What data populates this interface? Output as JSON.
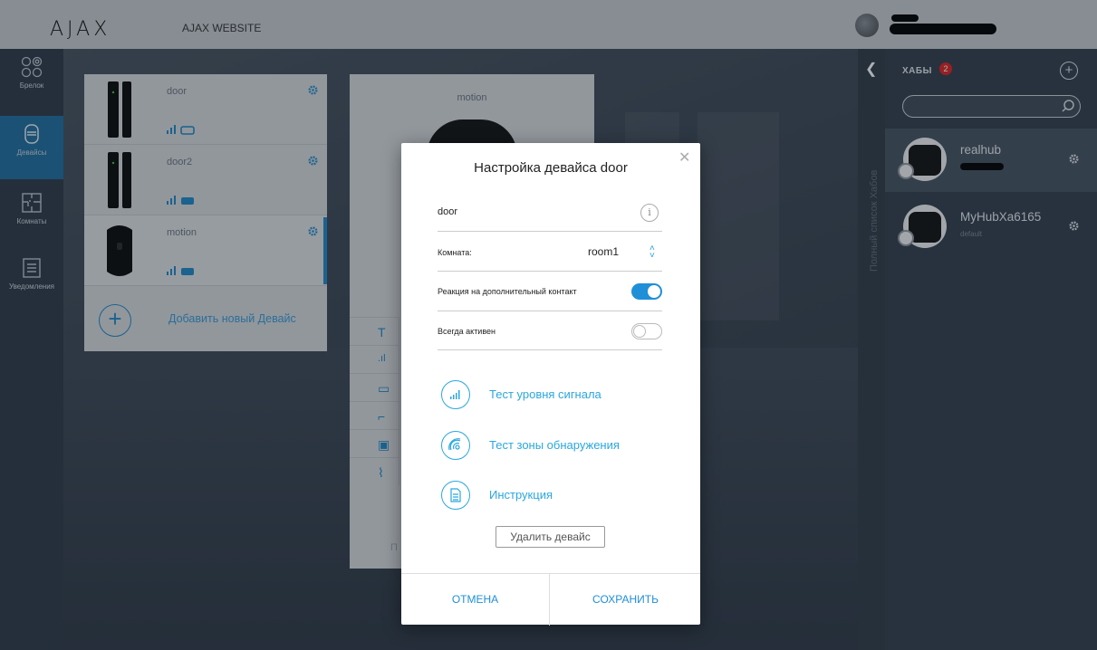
{
  "topbar": {
    "logo": "AJAX",
    "site_link": "AJAX WEBSITE"
  },
  "nav": {
    "items": [
      {
        "label": "Брелок"
      },
      {
        "label": "Девайсы"
      },
      {
        "label": "Комнаты"
      },
      {
        "label": "Уведомления"
      }
    ]
  },
  "devices": {
    "items": [
      {
        "name": "door"
      },
      {
        "name": "door2"
      },
      {
        "name": "motion"
      }
    ],
    "add_label": "Добавить новый Девайс"
  },
  "detail": {
    "title": "motion",
    "bottom_text": "П"
  },
  "hubs": {
    "collapse_label": "Полный список Хабов",
    "title": "ХАБЫ",
    "count": "2",
    "items": [
      {
        "name": "realhub"
      },
      {
        "name": "MyHubXa6165",
        "sub": "default"
      }
    ]
  },
  "modal": {
    "title": "Настройка девайса door",
    "name_value": "door",
    "room_label": "Комната:",
    "room_value": "room1",
    "reaction_label": "Реакция на дополнительный контакт",
    "reaction_on": true,
    "always_active_label": "Всегда активен",
    "always_active_on": false,
    "actions": [
      {
        "label": "Тест уровня сигнала"
      },
      {
        "label": "Тест зоны обнаружения"
      },
      {
        "label": "Инструкция"
      }
    ],
    "delete_label": "Удалить девайс",
    "cancel_label": "ОТМЕНА",
    "save_label": "СОХРАНИТЬ"
  },
  "colors": {
    "accent": "#1f8fd8",
    "nav_active": "#1f6d9e",
    "badge": "#dd2222"
  }
}
